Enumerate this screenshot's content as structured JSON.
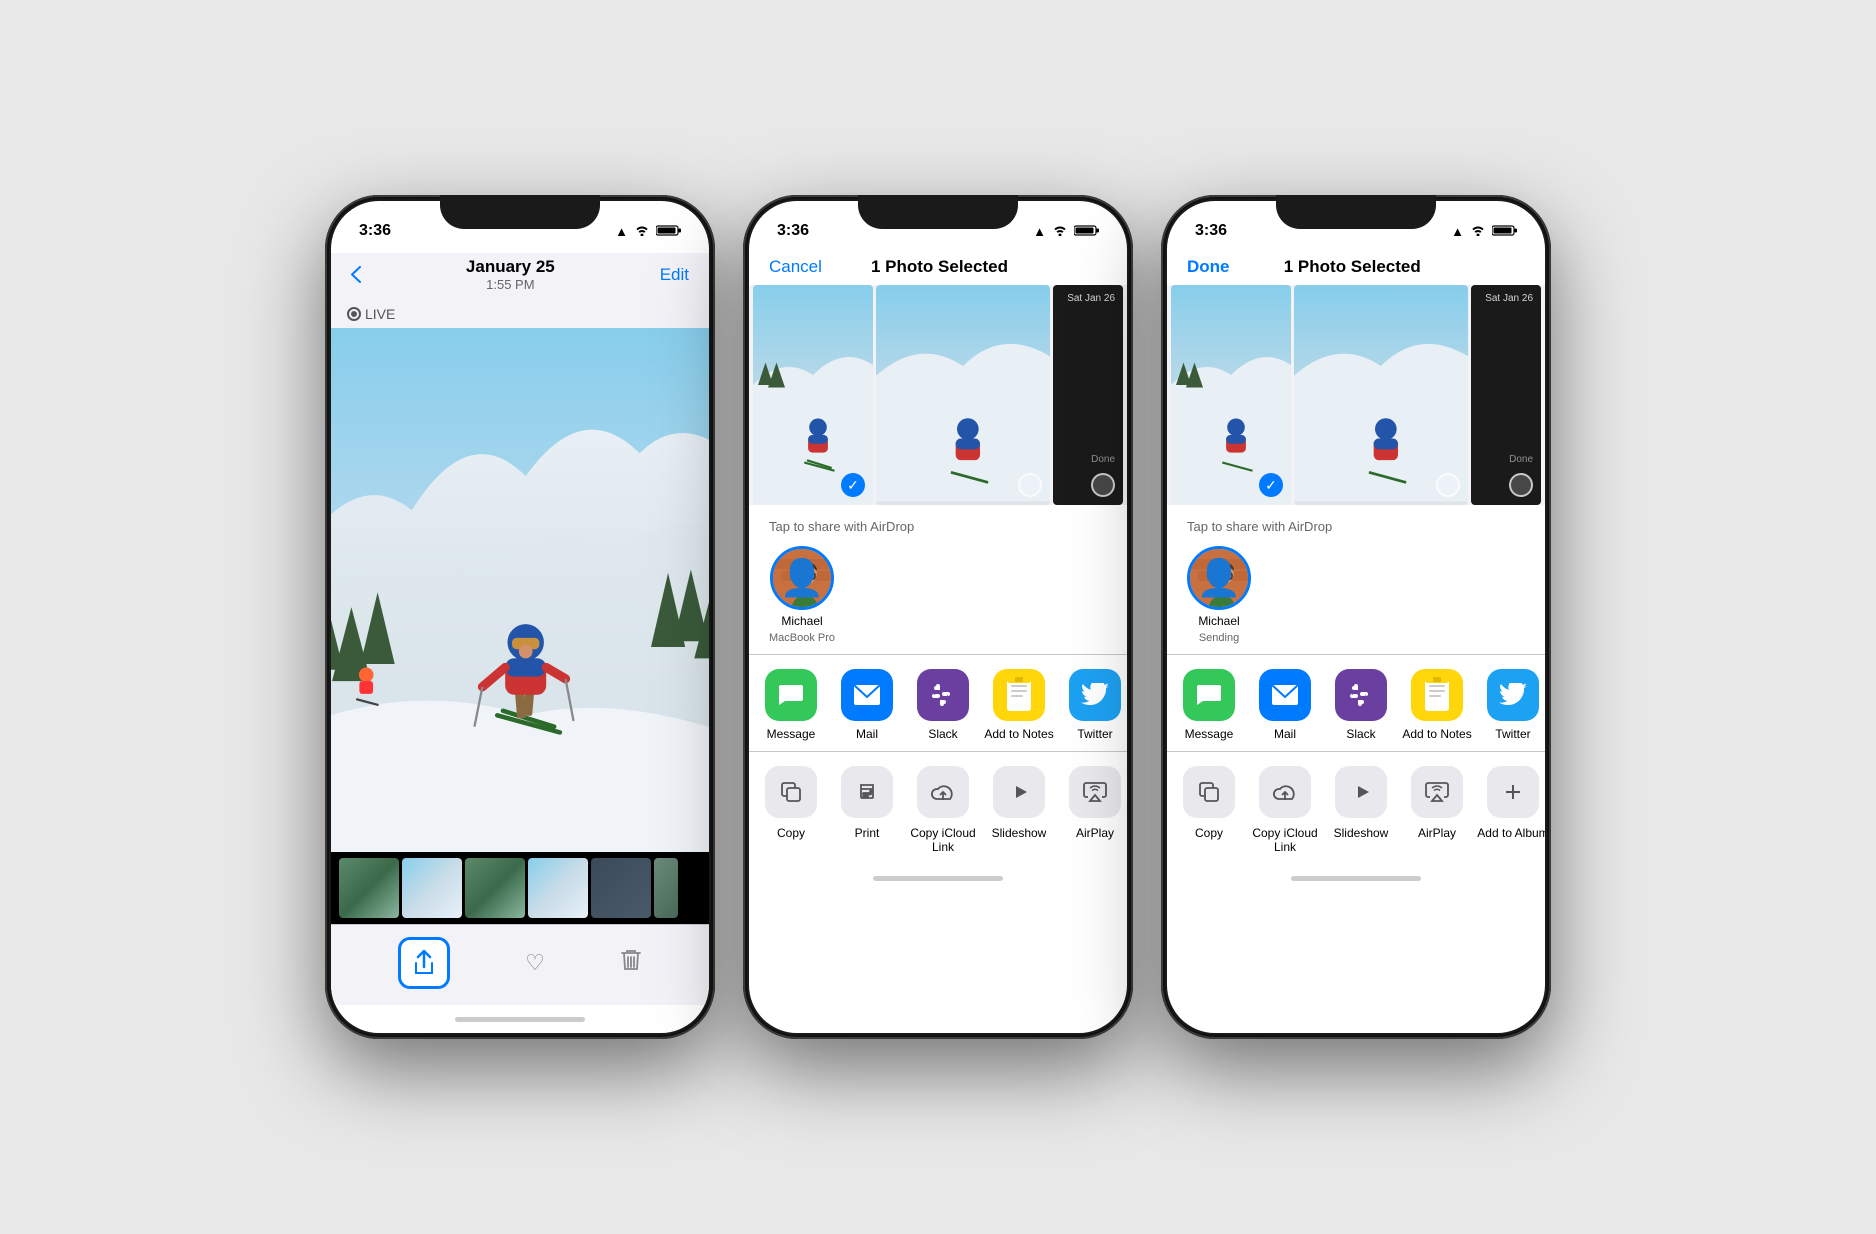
{
  "phones": [
    {
      "id": "phone1",
      "statusBar": {
        "time": "3:36",
        "signal": "▲",
        "wifi": "WiFi",
        "battery": "Battery"
      },
      "nav": {
        "back": "<",
        "title": "January 25",
        "subtitle": "1:55 PM",
        "action": "Edit"
      },
      "live": "LIVE",
      "toolbar": {
        "share": "share",
        "heart": "♡",
        "trash": "🗑"
      }
    },
    {
      "id": "phone2",
      "statusBar": {
        "time": "3:36"
      },
      "nav": {
        "cancel": "Cancel",
        "title": "1 Photo Selected",
        "done": null
      },
      "airdrop": {
        "label": "Tap to share with AirDrop",
        "contact": {
          "name": "Michael",
          "sub": "MacBook Pro"
        }
      },
      "apps": [
        {
          "label": "Message",
          "icon": "💬",
          "color": "green"
        },
        {
          "label": "Mail",
          "icon": "✉️",
          "color": "blue"
        },
        {
          "label": "Slack",
          "icon": "S",
          "color": "purple"
        },
        {
          "label": "Add to Notes",
          "icon": "notes",
          "color": "yellow"
        },
        {
          "label": "Twitter",
          "icon": "🐦",
          "color": "twitter-blue"
        }
      ],
      "actions": [
        {
          "label": "Copy",
          "icon": "⧉"
        },
        {
          "label": "Print",
          "icon": "🖨"
        },
        {
          "label": "Copy iCloud Link",
          "icon": "🔗"
        },
        {
          "label": "Slideshow",
          "icon": "▶"
        },
        {
          "label": "AirPlay",
          "icon": "⊕"
        }
      ]
    },
    {
      "id": "phone3",
      "statusBar": {
        "time": "3:36"
      },
      "nav": {
        "cancel": null,
        "title": "1 Photo Selected",
        "done": "Done"
      },
      "airdrop": {
        "label": "Tap to share with AirDrop",
        "contact": {
          "name": "Michael",
          "sub": "Sending"
        }
      },
      "apps": [
        {
          "label": "Message",
          "icon": "💬",
          "color": "green"
        },
        {
          "label": "Mail",
          "icon": "✉️",
          "color": "blue"
        },
        {
          "label": "Slack",
          "icon": "S",
          "color": "purple"
        },
        {
          "label": "Add to Notes",
          "icon": "notes",
          "color": "yellow"
        },
        {
          "label": "Twitter",
          "icon": "🐦",
          "color": "twitter-blue"
        }
      ],
      "actions": [
        {
          "label": "Copy",
          "icon": "⧉"
        },
        {
          "label": "Copy iCloud Link",
          "icon": "🔗"
        },
        {
          "label": "Slideshow",
          "icon": "▶"
        },
        {
          "label": "AirPlay",
          "icon": "⊕"
        },
        {
          "label": "Add to Album",
          "icon": "+"
        }
      ]
    }
  ]
}
